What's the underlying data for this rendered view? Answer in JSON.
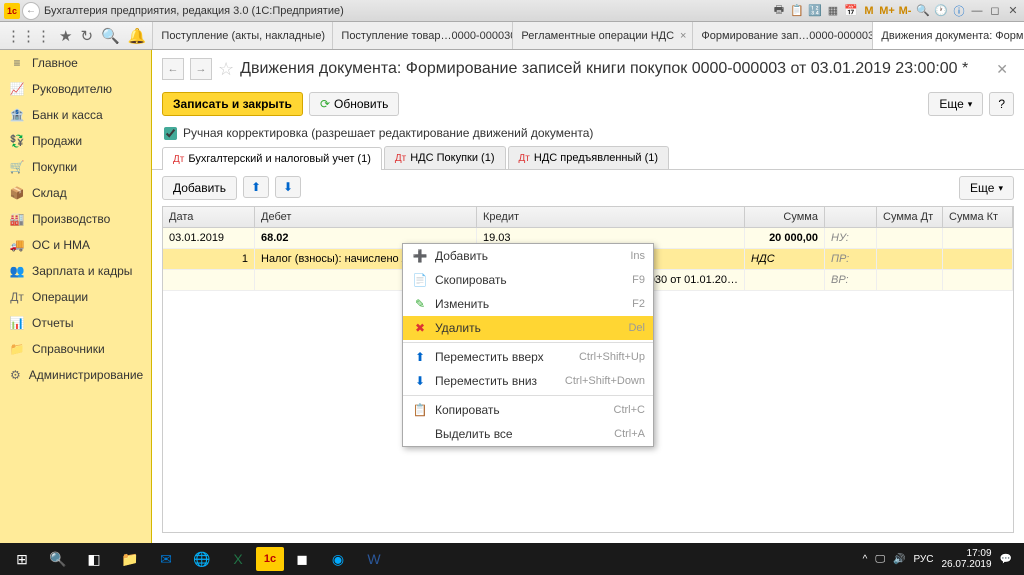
{
  "window": {
    "title": "Бухгалтерия предприятия, редакция 3.0  (1С:Предприятие)"
  },
  "mainTabs": [
    {
      "label": "Поступление (акты, накладные)",
      "active": false
    },
    {
      "label": "Поступление товар…0000-000030",
      "active": false
    },
    {
      "label": "Регламентные операции НДС",
      "active": false
    },
    {
      "label": "Формирование зап…0000-000003",
      "active": false
    },
    {
      "label": "Движения документа: Формир…",
      "active": true
    }
  ],
  "sidebar": {
    "items": [
      {
        "icon": "≡",
        "label": "Главное"
      },
      {
        "icon": "📈",
        "label": "Руководителю"
      },
      {
        "icon": "🏦",
        "label": "Банк и касса"
      },
      {
        "icon": "💱",
        "label": "Продажи"
      },
      {
        "icon": "🛒",
        "label": "Покупки"
      },
      {
        "icon": "📦",
        "label": "Склад"
      },
      {
        "icon": "🏭",
        "label": "Производство"
      },
      {
        "icon": "🚚",
        "label": "ОС и НМА"
      },
      {
        "icon": "👥",
        "label": "Зарплата и кадры"
      },
      {
        "icon": "Дт",
        "label": "Операции"
      },
      {
        "icon": "📊",
        "label": "Отчеты"
      },
      {
        "icon": "📁",
        "label": "Справочники"
      },
      {
        "icon": "⚙",
        "label": "Администрирование"
      }
    ]
  },
  "document": {
    "title": "Движения документа: Формирование записей книги покупок 0000-000003 от 03.01.2019 23:00:00 *",
    "saveClose": "Записать и закрыть",
    "refresh": "Обновить",
    "more": "Еще",
    "help": "?",
    "checkbox": "Ручная корректировка (разрешает редактирование движений документа)",
    "tabs": [
      {
        "label": "Бухгалтерский и налоговый учет (1)",
        "active": true
      },
      {
        "label": "НДС Покупки (1)",
        "active": false
      },
      {
        "label": "НДС предъявленный (1)",
        "active": false
      }
    ],
    "addBtn": "Добавить",
    "gridMore": "Еще"
  },
  "grid": {
    "headers": {
      "date": "Дата",
      "debet": "Дебет",
      "kredit": "Кредит",
      "sum": "Сумма",
      "sumDt": "Сумма Дт",
      "sumKt": "Сумма Кт"
    },
    "row1": {
      "date": "03.01.2019",
      "debet": "68.02",
      "kredit": "19.03",
      "sum": "20 000,00",
      "nu": "НУ:"
    },
    "row2": {
      "num": "1",
      "debet": "Налог (взносы): начислено / уп",
      "kredit2": "030 от 01.01.20…",
      "nds": "НДС",
      "pr": "ПР:",
      "vr": "ВР:"
    }
  },
  "contextMenu": {
    "items": [
      {
        "icon": "➕",
        "iconColor": "#3a3",
        "label": "Добавить",
        "key": "Ins"
      },
      {
        "icon": "📄",
        "iconColor": "#888",
        "label": "Скопировать",
        "key": "F9"
      },
      {
        "icon": "✎",
        "iconColor": "#3a3",
        "label": "Изменить",
        "key": "F2"
      },
      {
        "icon": "✖",
        "iconColor": "#d33",
        "label": "Удалить",
        "key": "Del",
        "highlight": true
      },
      {
        "sep": true
      },
      {
        "icon": "⬆",
        "iconColor": "#06c",
        "label": "Переместить вверх",
        "key": "Ctrl+Shift+Up"
      },
      {
        "icon": "⬇",
        "iconColor": "#06c",
        "label": "Переместить вниз",
        "key": "Ctrl+Shift+Down"
      },
      {
        "sep": true
      },
      {
        "icon": "📋",
        "iconColor": "#888",
        "label": "Копировать",
        "key": "Ctrl+C"
      },
      {
        "icon": "",
        "label": "Выделить все",
        "key": "Ctrl+A"
      }
    ]
  },
  "taskbar": {
    "lang": "РУС",
    "time": "17:09",
    "date": "26.07.2019"
  }
}
